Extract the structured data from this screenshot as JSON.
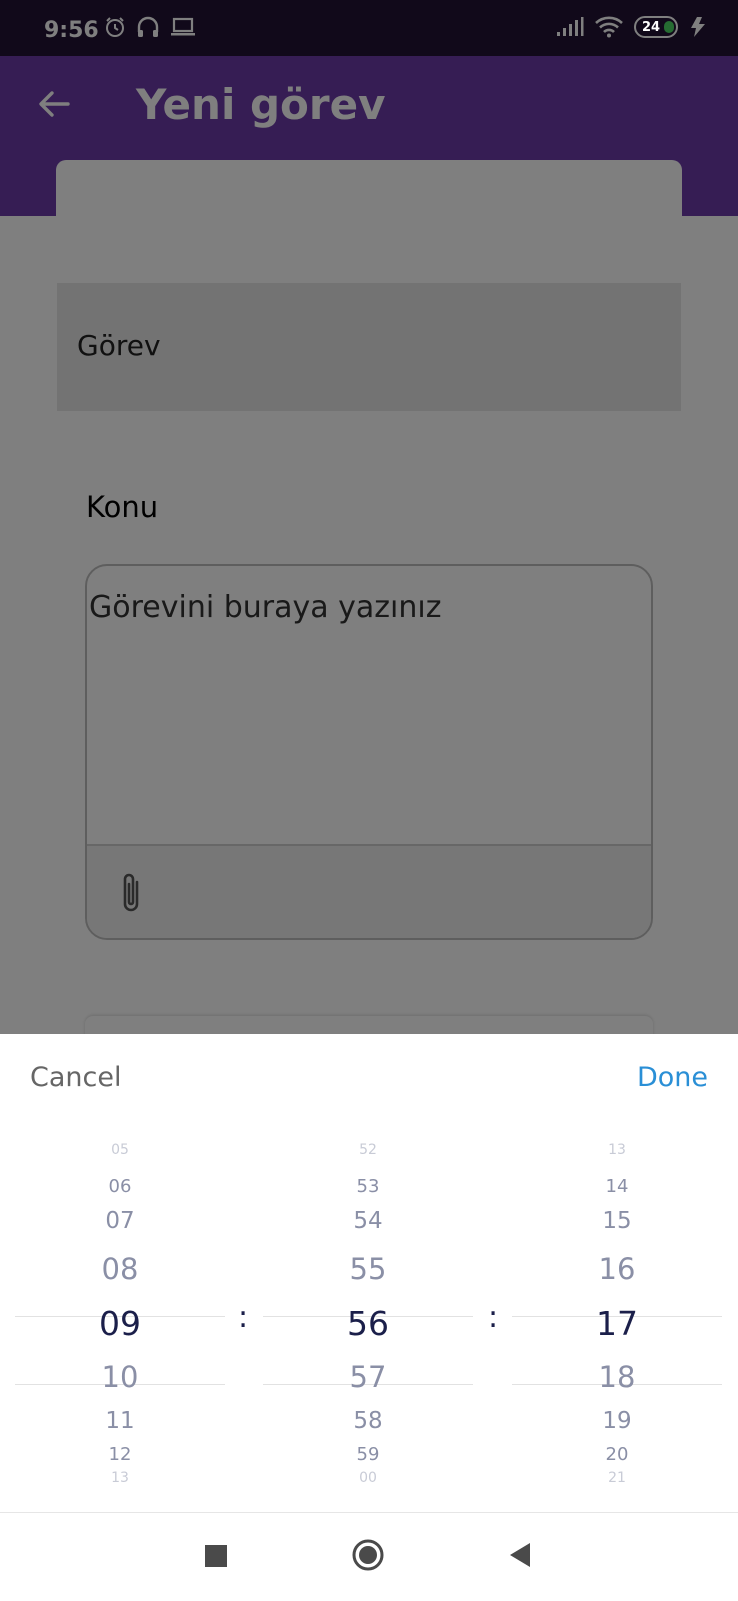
{
  "status_bar": {
    "time": "9:56",
    "battery_level": "24",
    "icons": [
      "alarm-icon",
      "headphones-icon",
      "laptop-icon",
      "signal-icon",
      "wifi-icon",
      "battery-icon",
      "charging-icon"
    ]
  },
  "app_bar": {
    "title": "Yeni görev",
    "back_icon": "back-arrow-icon"
  },
  "form": {
    "task_type_label": "Görev",
    "subject_label": "Konu",
    "description_placeholder": "Görevini buraya yazınız",
    "attach_icon": "paperclip-icon"
  },
  "time_picker": {
    "cancel_label": "Cancel",
    "done_label": "Done",
    "separator": ":",
    "hours": [
      "05",
      "06",
      "07",
      "08",
      "09",
      "10",
      "11",
      "12",
      "13"
    ],
    "minutes": [
      "52",
      "53",
      "54",
      "55",
      "56",
      "57",
      "58",
      "59",
      "00"
    ],
    "seconds": [
      "13",
      "14",
      "15",
      "16",
      "17",
      "18",
      "19",
      "20",
      "21"
    ],
    "selected": {
      "hour": "09",
      "minute": "56",
      "second": "17"
    }
  },
  "colors": {
    "status_bar": "#221335",
    "app_bar": "#6c3aa8",
    "done_button": "#2a8fd6",
    "selected_value": "#1b1f4a",
    "unselected_value": "#8a8fa6"
  },
  "nav_bar": {
    "icons": [
      "recents-square-icon",
      "home-circle-icon",
      "back-triangle-icon"
    ]
  }
}
